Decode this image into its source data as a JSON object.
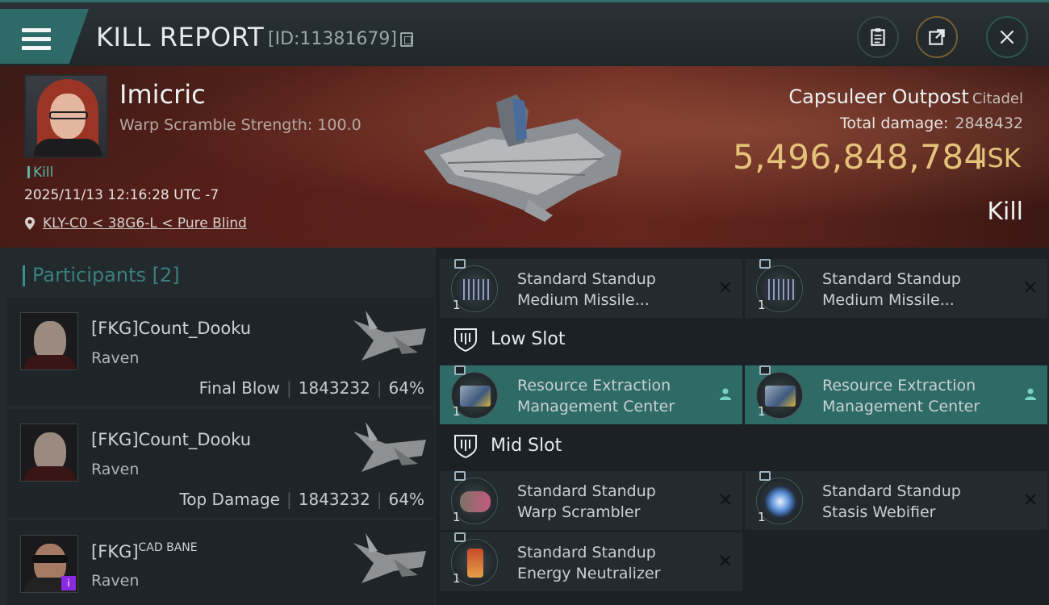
{
  "header": {
    "title": "KILL REPORT",
    "report_id": "[ID:11381679]"
  },
  "victim": {
    "name": "Imicric",
    "detail": "Warp Scramble Strength: 100.0",
    "result_tag": "Kill",
    "datetime": "2025/11/13 12:16:28 UTC -7",
    "location": "KLY-C0 < 38G6-L < Pure Blind"
  },
  "structure": {
    "name": "Capsuleer Outpost",
    "class": "Citadel",
    "total_damage_label": "Total damage:",
    "total_damage": "2848432",
    "isk_value": "5,496,848,784",
    "isk_unit": "ISK",
    "outcome": "Kill"
  },
  "participants": {
    "heading": "Participants [2]",
    "rows": [
      {
        "name": "[FKG]Count_Dooku",
        "name_sup": "",
        "ship": "Raven",
        "role": "Final Blow",
        "damage": "1843232",
        "percent": "64%"
      },
      {
        "name": "[FKG]Count_Dooku",
        "name_sup": "",
        "ship": "Raven",
        "role": "Top Damage",
        "damage": "1843232",
        "percent": "64%"
      },
      {
        "name": "[FKG]",
        "name_sup": "CAD BANE",
        "ship": "Raven",
        "role": "",
        "damage": "",
        "percent": ""
      }
    ]
  },
  "modules": {
    "top_row": [
      {
        "qty": "1",
        "line1": "Standard Standup",
        "line2": "Medium Missile..."
      },
      {
        "qty": "1",
        "line1": "Standard Standup",
        "line2": "Medium Missile..."
      }
    ],
    "low_slot_label": "Low Slot",
    "low_slot": [
      {
        "qty": "1",
        "line1": "Resource Extraction",
        "line2": "Management Center"
      },
      {
        "qty": "1",
        "line1": "Resource Extraction",
        "line2": "Management Center"
      }
    ],
    "mid_slot_label": "Mid Slot",
    "mid_slot": [
      {
        "qty": "1",
        "line1": "Standard Standup",
        "line2": "Warp Scrambler"
      },
      {
        "qty": "1",
        "line1": "Standard Standup",
        "line2": "Stasis Webifier"
      },
      {
        "qty": "1",
        "line1": "Standard Standup",
        "line2": "Energy Neutralizer"
      }
    ]
  },
  "colors": {
    "accent_teal": "#2f6b66",
    "isk_gold": "#e5c27a",
    "badge_purple": "#8a2be2"
  }
}
